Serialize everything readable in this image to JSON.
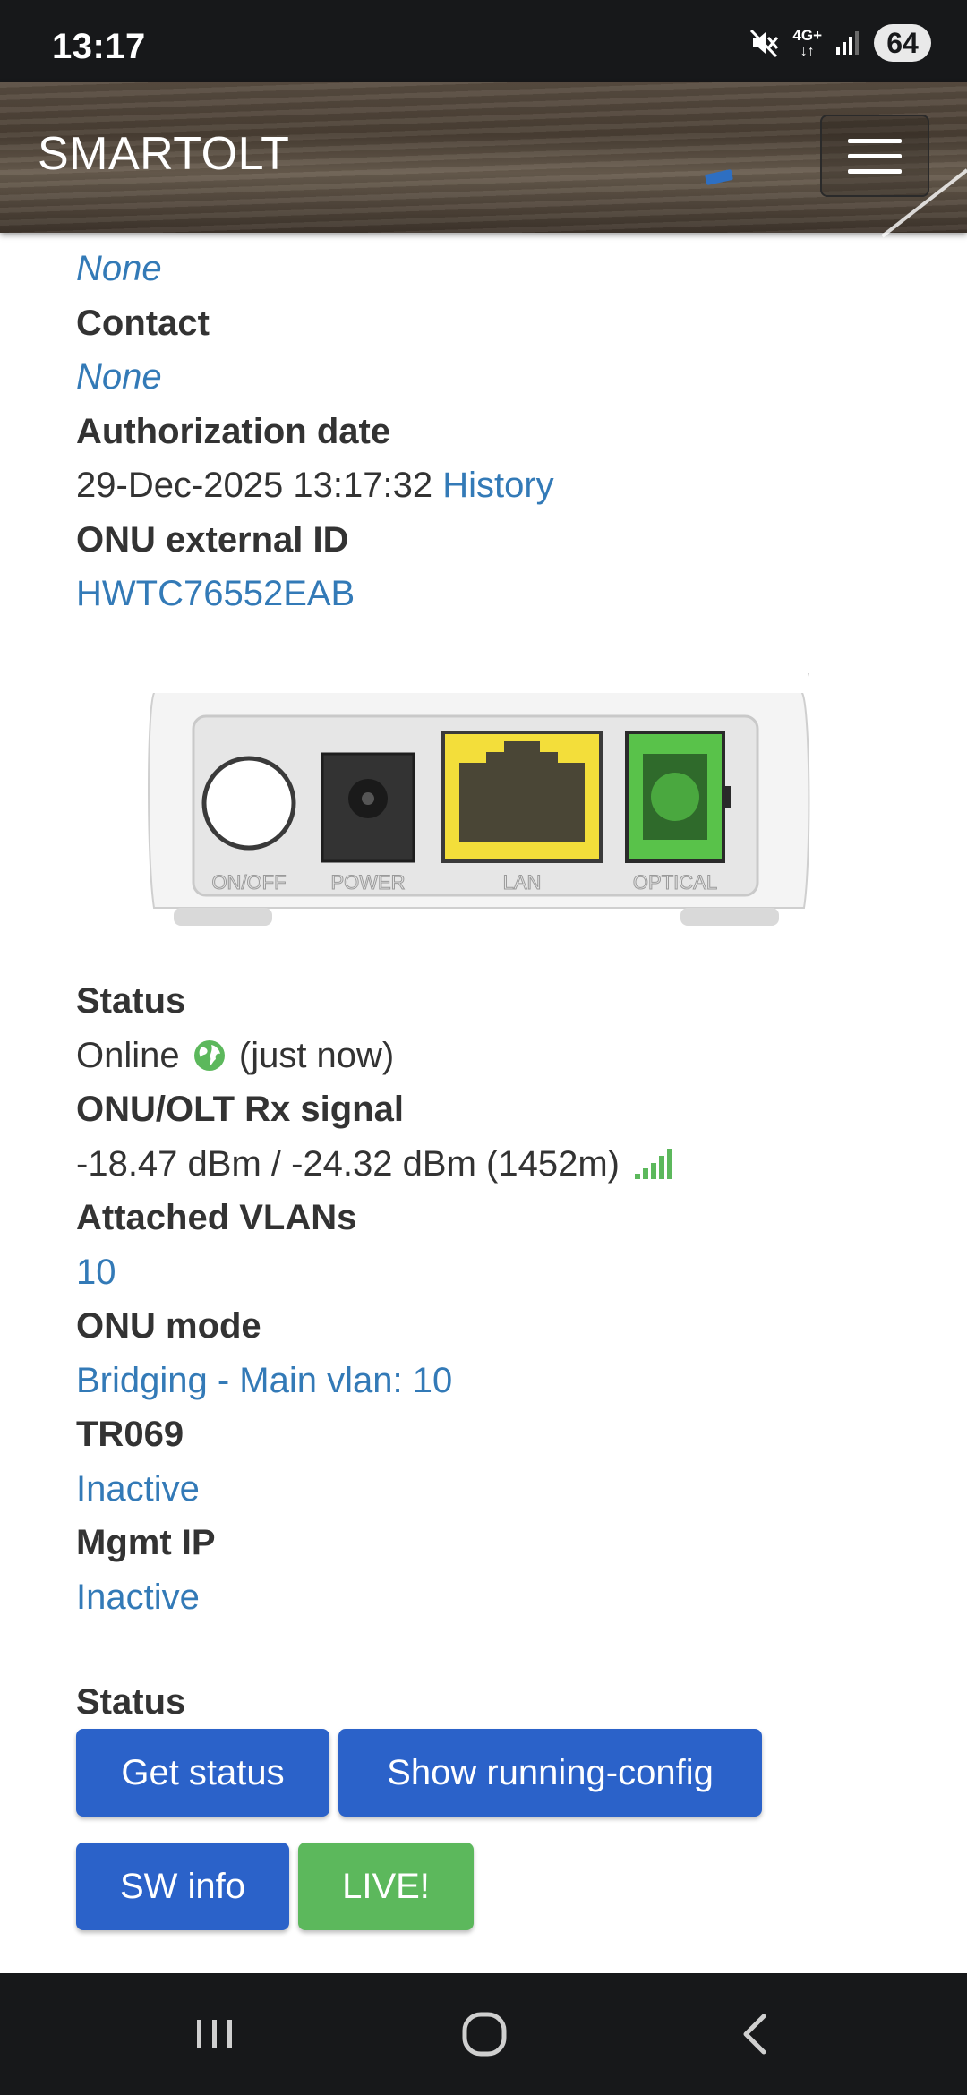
{
  "status_bar": {
    "time": "13:17",
    "network": "4G+",
    "battery": "64",
    "icons": [
      "mute-icon",
      "network-4g-icon",
      "signal-icon",
      "battery-icon"
    ]
  },
  "header": {
    "brand": "SMARTOLT",
    "menu_icon": "hamburger-menu-icon"
  },
  "details": {
    "address_value": "None",
    "contact_label": "Contact",
    "contact_value": "None",
    "auth_date_label": "Authorization date",
    "auth_date_value": "29-Dec-2025 13:17:32",
    "history_link": "History",
    "external_id_label": "ONU external ID",
    "external_id_value": "HWTC76552EAB"
  },
  "device_image": {
    "ports": [
      "ON/OFF",
      "POWER",
      "LAN",
      "OPTICAL"
    ]
  },
  "info": {
    "status_label": "Status",
    "status_value": "Online",
    "status_time": "(just now)",
    "rx_label": "ONU/OLT Rx signal",
    "rx_value": "-18.47 dBm / -24.32 dBm (1452m)",
    "vlans_label": "Attached VLANs",
    "vlans_value": "10",
    "mode_label": "ONU mode",
    "mode_value": "Bridging - Main vlan: 10",
    "tr069_label": "TR069",
    "tr069_value": "Inactive",
    "mgmt_label": "Mgmt IP",
    "mgmt_value": "Inactive"
  },
  "actions": {
    "title": "Status",
    "get_status": "Get status",
    "show_running_config": "Show running-config",
    "sw_info": "SW info",
    "live": "LIVE!"
  },
  "colors": {
    "link": "#337ab7",
    "button_blue": "#2b62c9",
    "button_green": "#5cb85c",
    "signal_green": "#5cb85c"
  }
}
